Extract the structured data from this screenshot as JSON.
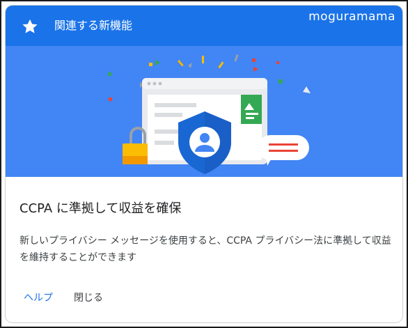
{
  "header": {
    "title": "関連する新機能",
    "icon": "star-icon",
    "background": "#1a73e8"
  },
  "watermark": "moguramama",
  "hero": {
    "background": "#4285f4",
    "icons": [
      "browser-window-icon",
      "shield-user-icon",
      "padlock-icon",
      "image-icon",
      "chat-bubble-icon",
      "confetti-icon"
    ]
  },
  "content": {
    "title": "CCPA に準拠して収益を確保",
    "description": "新しいプライバシー メッセージを使用すると、CCPA プライバシー法に準拠して収益を維持することができます"
  },
  "actions": {
    "help_label": "ヘルプ",
    "close_label": "閉じる",
    "accent": "#1a73e8"
  }
}
